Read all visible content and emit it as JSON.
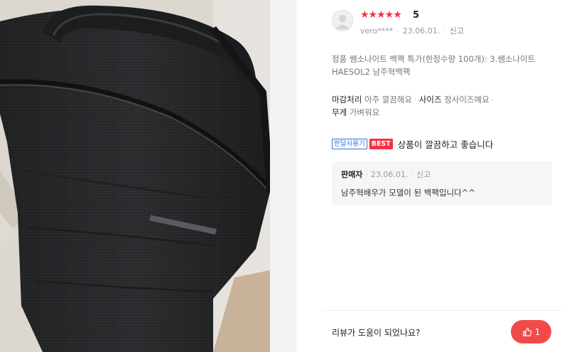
{
  "review": {
    "rating_stars": "★★★★★",
    "rating_value": "5",
    "user": "vero****",
    "date": "23.06.01.",
    "report_label": "신고",
    "option_line": "정품 쌤소나이트 백팩 특가(한정수량 100개): 3.쌤소나이트 HAESOL2 남주혁백팩",
    "attributes": [
      {
        "key": "마감처리",
        "value": "아주 깔끔해요"
      },
      {
        "key": "사이즈",
        "value": "정사이즈예요"
      },
      {
        "key": "무게",
        "value": "가벼워요"
      }
    ],
    "badge_month": "한달사용기",
    "badge_best": "BEST",
    "text": "상품이 깔끔하고 좋습니다"
  },
  "seller_reply": {
    "label": "판매자",
    "date": "23.06.01.",
    "report_label": "신고",
    "text": "남주혁배우가 모델이 된 백팩입니다^^"
  },
  "helpful": {
    "question": "리뷰가 도움이 되었나요?",
    "count": "1"
  },
  "colors": {
    "accent_red": "#f43142",
    "like_button": "#f04b4b",
    "badge_blue": "#3b6fd1"
  },
  "icons": {
    "like": "thumbs-up-icon",
    "avatar": "user-avatar-icon"
  }
}
